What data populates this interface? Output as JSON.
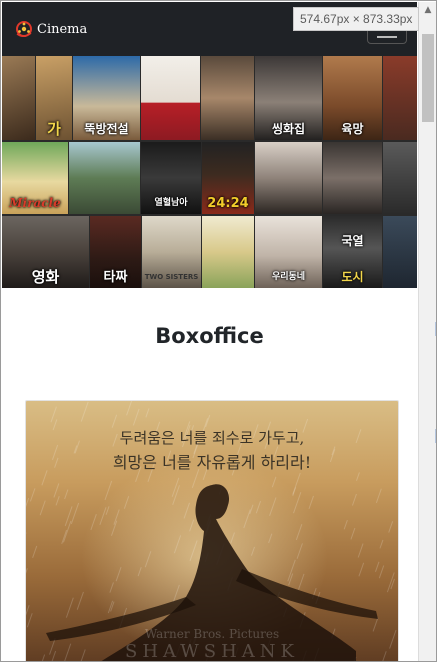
{
  "devtools": {
    "dimensions": "574.67px × 873.33px"
  },
  "navbar": {
    "brand_text": "Cinema",
    "toggler_icon": "hamburger-icon"
  },
  "hero": {
    "poster_titles": [
      "가",
      "뚝방전설",
      "씽화집",
      "육망",
      "Miracle",
      "열혈남아",
      "24:24",
      "국열",
      "영화",
      "타짜",
      "TWO SISTERS",
      "우리동네",
      "도시"
    ]
  },
  "section": {
    "heading": "Boxoffice"
  },
  "feature": {
    "line1": "두려움은 너를 죄수로 가두고,",
    "line2": "희망은 너를 자유롭게 하리라!",
    "faint_credit": "Warner Bros. Pictures",
    "faint_title": "SHAWSHANK"
  },
  "colors": {
    "navbar_bg": "#1f2226",
    "heading": "#212529",
    "page_bg": "#ffffff"
  }
}
